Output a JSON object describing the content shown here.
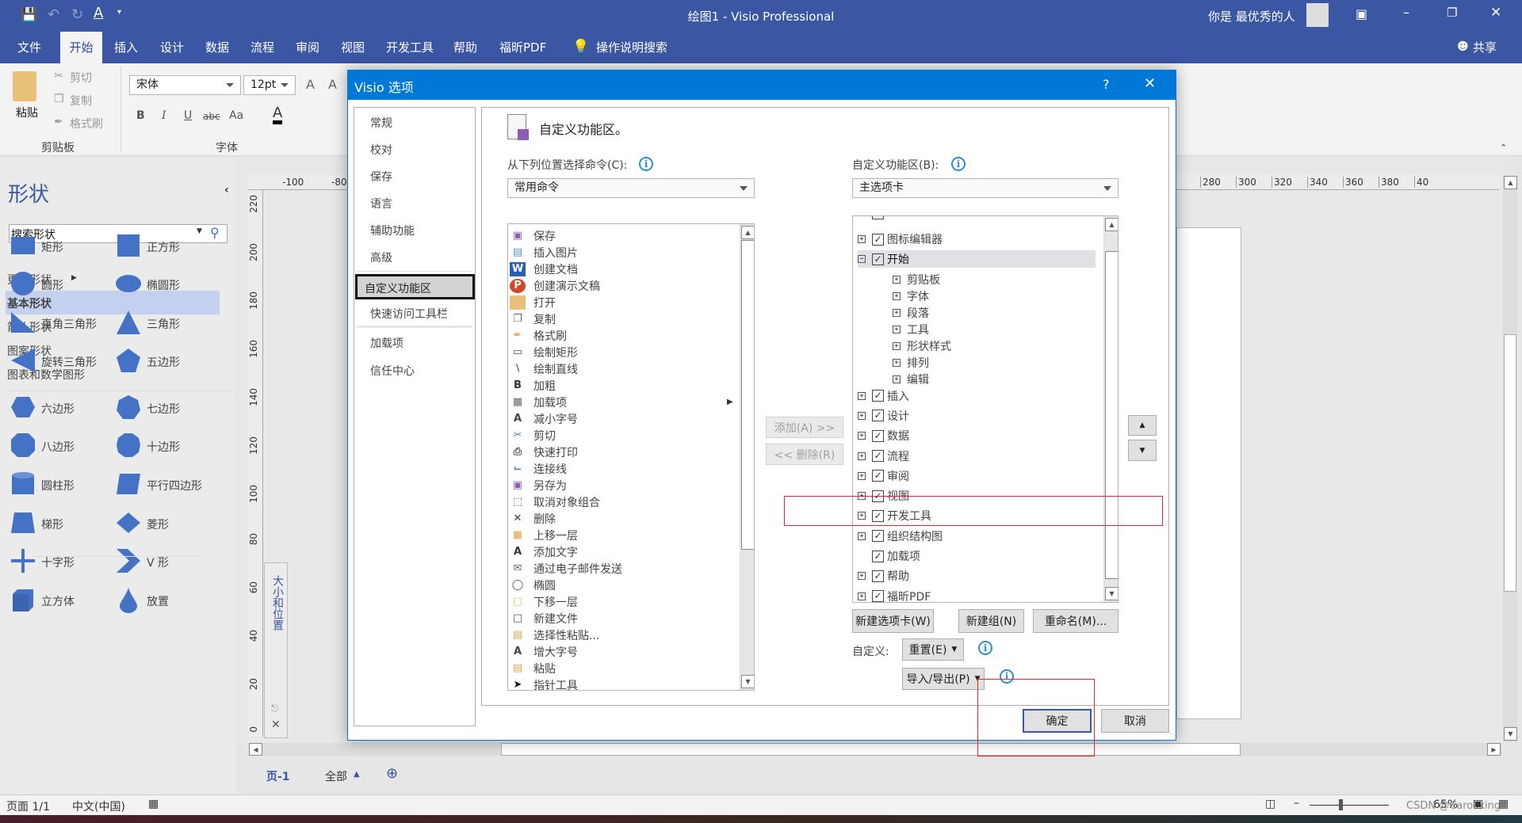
{
  "app": {
    "title": "绘图1 - Visio Professional",
    "user": "你是 最优秀的人",
    "share": "共享"
  },
  "ribbon_tabs": [
    "文件",
    "开始",
    "插入",
    "设计",
    "数据",
    "流程",
    "审阅",
    "视图",
    "开发工具",
    "帮助",
    "福昕PDF"
  ],
  "tell_me": "操作说明搜索",
  "ribbon": {
    "paste": "粘贴",
    "cut": "剪切",
    "copy": "复制",
    "format_painter": "格式刷",
    "clipboard_group": "剪贴板",
    "font_name": "宋体",
    "font_size": "12pt",
    "font_group": "字体",
    "bold": "B",
    "italic": "I",
    "underline": "U",
    "strike": "abc",
    "case": "Aa",
    "font_color": "A",
    "grow": "A",
    "shrink": "A"
  },
  "shapes_panel": {
    "title": "形状",
    "search_placeholder": "搜索形状",
    "more": "更多形状",
    "categories": [
      "基本形状",
      "箭头形状",
      "图案形状",
      "图表和数学图形"
    ],
    "selected_category": "基本形状",
    "shapes": [
      "矩形",
      "正方形",
      "圆形",
      "椭圆形",
      "直角三角形",
      "三角形",
      "旋转三角形",
      "五边形",
      "六边形",
      "七边形",
      "八边形",
      "十边形",
      "圆柱形",
      "平行四边形",
      "梯形",
      "菱形",
      "十字形",
      "V 形",
      "立方体",
      "放置"
    ],
    "accent": "#4472c4"
  },
  "canvas": {
    "hruler_left": [
      "-100",
      "-80"
    ],
    "hruler_right": [
      "280",
      "300",
      "320",
      "340",
      "360",
      "380",
      "40"
    ],
    "vruler": [
      "220",
      "200",
      "180",
      "160",
      "140",
      "120",
      "100",
      "80",
      "60",
      "40",
      "20",
      "0"
    ],
    "size_position_panel": "大小和位置",
    "page_tab": "页-1",
    "all_pages": "全部"
  },
  "status": {
    "page": "页面 1/1",
    "language": "中文(中国)",
    "zoom": "65%",
    "watermark": "CSDN @Carollking"
  },
  "dialog": {
    "title": "Visio 选项",
    "help": "?",
    "nav": [
      "常规",
      "校对",
      "保存",
      "语言",
      "辅助功能",
      "高级",
      "自定义功能区",
      "快速访问工具栏",
      "加载项",
      "信任中心"
    ],
    "selected_nav": "自定义功能区",
    "header": "自定义功能区。",
    "choose_label": "从下列位置选择命令(C):",
    "choose_value": "常用命令",
    "customize_label": "自定义功能区(B):",
    "customize_value": "主选项卡",
    "commands": [
      {
        "label": "保存",
        "icon": "save"
      },
      {
        "label": "插入图片",
        "icon": "picture"
      },
      {
        "label": "创建文档",
        "icon": "word"
      },
      {
        "label": "创建演示文稿",
        "icon": "powerpoint"
      },
      {
        "label": "打开",
        "icon": "folder"
      },
      {
        "label": "复制",
        "icon": "copy"
      },
      {
        "label": "格式刷",
        "icon": "brush"
      },
      {
        "label": "绘制矩形",
        "icon": "rect"
      },
      {
        "label": "绘制直线",
        "icon": "line"
      },
      {
        "label": "加粗",
        "icon": "bold"
      },
      {
        "label": "加载项",
        "icon": "addins",
        "submenu": true
      },
      {
        "label": "减小字号",
        "icon": "font-shrink"
      },
      {
        "label": "剪切",
        "icon": "scissors"
      },
      {
        "label": "快速打印",
        "icon": "print"
      },
      {
        "label": "连接线",
        "icon": "connector"
      },
      {
        "label": "另存为",
        "icon": "save-as"
      },
      {
        "label": "取消对象组合",
        "icon": "ungroup"
      },
      {
        "label": "删除",
        "icon": "delete"
      },
      {
        "label": "上移一层",
        "icon": "bring-forward"
      },
      {
        "label": "添加文字",
        "icon": "text"
      },
      {
        "label": "通过电子邮件发送",
        "icon": "email"
      },
      {
        "label": "椭圆",
        "icon": "ellipse"
      },
      {
        "label": "下移一层",
        "icon": "send-backward"
      },
      {
        "label": "新建文件",
        "icon": "new-file"
      },
      {
        "label": "选择性粘贴...",
        "icon": "paste-special"
      },
      {
        "label": "增大字号",
        "icon": "font-grow"
      },
      {
        "label": "粘贴",
        "icon": "paste"
      },
      {
        "label": "指针工具",
        "icon": "pointer"
      }
    ],
    "tree": [
      {
        "label": "图标编辑器",
        "level": 0,
        "expander": "+",
        "checked": true
      },
      {
        "label": "开始",
        "level": 0,
        "expander": "-",
        "checked": true,
        "selected": true
      },
      {
        "label": "剪贴板",
        "level": 1,
        "expander": "+"
      },
      {
        "label": "字体",
        "level": 1,
        "expander": "+"
      },
      {
        "label": "段落",
        "level": 1,
        "expander": "+"
      },
      {
        "label": "工具",
        "level": 1,
        "expander": "+"
      },
      {
        "label": "形状样式",
        "level": 1,
        "expander": "+"
      },
      {
        "label": "排列",
        "level": 1,
        "expander": "+"
      },
      {
        "label": "编辑",
        "level": 1,
        "expander": "+"
      },
      {
        "label": "插入",
        "level": 0,
        "expander": "+",
        "checked": true
      },
      {
        "label": "设计",
        "level": 0,
        "expander": "+",
        "checked": true
      },
      {
        "label": "数据",
        "level": 0,
        "expander": "+",
        "checked": true
      },
      {
        "label": "流程",
        "level": 0,
        "expander": "+",
        "checked": true
      },
      {
        "label": "审阅",
        "level": 0,
        "expander": "+",
        "checked": true
      },
      {
        "label": "视图",
        "level": 0,
        "expander": "+",
        "checked": true
      },
      {
        "label": "开发工具",
        "level": 0,
        "expander": "+",
        "checked": true
      },
      {
        "label": "组织结构图",
        "level": 0,
        "expander": "+",
        "checked": true
      },
      {
        "label": "加载项",
        "level": 0,
        "expander": "",
        "checked": true
      },
      {
        "label": "帮助",
        "level": 0,
        "expander": "+",
        "checked": true
      },
      {
        "label": "福昕PDF",
        "level": 0,
        "expander": "+",
        "checked": true
      }
    ],
    "add_button": "添加(A) >>",
    "remove_button": "<< 删除(R)",
    "new_tab": "新建选项卡(W)",
    "new_group": "新建组(N)",
    "rename": "重命名(M)...",
    "customize_text": "自定义:",
    "reset": "重置(E)",
    "import_export": "导入/导出(P)",
    "ok": "确定",
    "cancel": "取消",
    "accent": "#0078d7",
    "highlight": "#e8262b"
  }
}
